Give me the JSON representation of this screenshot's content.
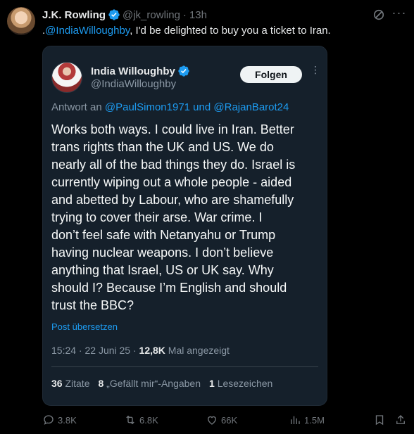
{
  "post": {
    "author_name": "J.K. Rowling",
    "handle": "@jk_rowling",
    "separator": "·",
    "time": "13h",
    "text_prefix": ".",
    "text_mention": "@IndiaWilloughby",
    "text_rest": ", I'd be delighted to buy you a ticket to Iran.",
    "more_label": "···"
  },
  "quote": {
    "author_name": "India Willoughby",
    "handle": "@IndiaWilloughby",
    "follow_label": "Folgen",
    "more_label": "⋮",
    "reply_prefix": "Antwort an ",
    "reply_mention_1": "@PaulSimon1971",
    "reply_and": " und ",
    "reply_mention_2": "@RajanBarot24",
    "body_lines": [
      "Works both ways. I could live in Iran. Better",
      "trans rights than the UK and US. We do",
      "nearly all of the bad things they do. Israel is",
      "currently wiping out a whole people - aided",
      "and abetted by Labour, who are shamefully",
      "trying to cover their arse. War crime.  I",
      "don’t feel safe with Netanyahu or Trump",
      "having nuclear weapons. I don’t believe",
      "anything that Israel, US or UK say. Why",
      "should I? Because I’m English and should",
      "trust the BBC?"
    ],
    "translate_label": "Post übersetzen",
    "meta_time": "15:24 · 22 Juni 25 · ",
    "views_count": "12,8K",
    "views_label": " Mal angezeigt",
    "quotes_count": "36",
    "quotes_label": "Zitate",
    "likes_count": "8",
    "likes_label": "„Gefällt mir“-Angaben",
    "bookmarks_count": "1",
    "bookmarks_label": "Lesezeichen"
  },
  "actions": {
    "replies": "3.8K",
    "reposts": "6.8K",
    "likes": "66K",
    "views": "1.5M"
  },
  "colors": {
    "accent": "#1d9bf0",
    "background": "#000000",
    "card": "#15202b"
  }
}
